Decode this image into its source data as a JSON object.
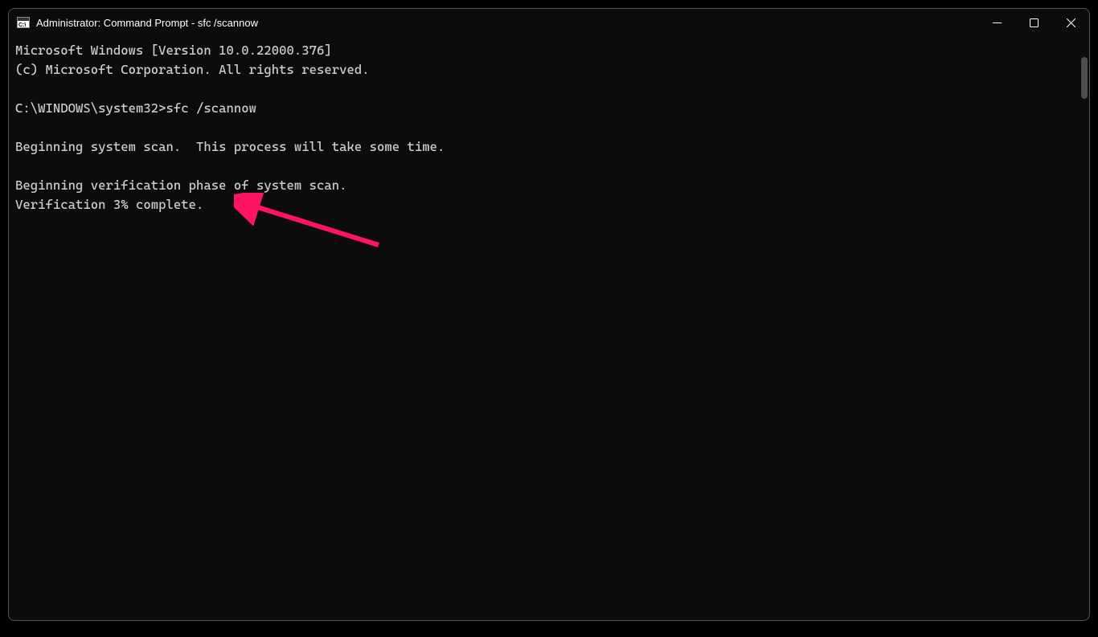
{
  "window": {
    "title": "Administrator: Command Prompt - sfc  /scannow",
    "icon_label": "C:\\"
  },
  "terminal": {
    "lines": {
      "l1": "Microsoft Windows [Version 10.0.22000.376]",
      "l2": "(c) Microsoft Corporation. All rights reserved.",
      "l3": "",
      "l4": "C:\\WINDOWS\\system32>sfc /scannow",
      "l5": "",
      "l6": "Beginning system scan.  This process will take some time.",
      "l7": "",
      "l8": "Beginning verification phase of system scan.",
      "l9": "Verification 3% complete."
    }
  },
  "annotation": {
    "arrow_color": "#ff1464"
  }
}
